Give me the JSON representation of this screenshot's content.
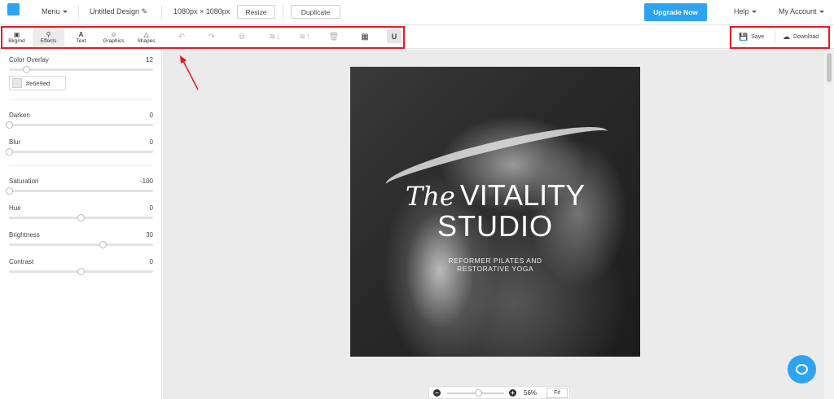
{
  "topbar": {
    "menu_label": "Menu",
    "design_name": "Untitled Design",
    "size_label": "1080px × 1080px",
    "resize_label": "Resize",
    "duplicate_label": "Duplicate",
    "upgrade_label": "Upgrade Now",
    "help_label": "Help",
    "account_label": "My Account",
    "accent_color": "#2ea3f2"
  },
  "toolbar": {
    "tools": [
      {
        "label": "Bkgrnd",
        "icon": "image-icon"
      },
      {
        "label": "Effects",
        "icon": "wand-icon"
      },
      {
        "label": "Text",
        "icon": "text-icon"
      },
      {
        "label": "Graphics",
        "icon": "smiley-icon"
      },
      {
        "label": "Shapes",
        "icon": "triangle-icon"
      }
    ],
    "actions": [
      "undo-icon",
      "redo-icon",
      "copy-icon",
      "layer-down-icon",
      "layer-up-icon",
      "trash-icon",
      "grid-icon",
      "magnet-icon"
    ],
    "save_label": "Save",
    "download_label": "Download"
  },
  "effects": {
    "color_overlay": {
      "label": "Color Overlay",
      "value": "12",
      "fraction": 0.12
    },
    "overlay_color": "#e6e9ed",
    "darken": {
      "label": "Darken",
      "value": "0",
      "fraction": 0.0
    },
    "blur": {
      "label": "Blur",
      "value": "0",
      "fraction": 0.0
    },
    "saturation": {
      "label": "Saturation",
      "value": "-100",
      "fraction": 0.0
    },
    "hue": {
      "label": "Hue",
      "value": "0",
      "fraction": 0.5
    },
    "brightness": {
      "label": "Brightness",
      "value": "30",
      "fraction": 0.65
    },
    "contrast": {
      "label": "Contrast",
      "value": "0",
      "fraction": 0.5
    }
  },
  "design": {
    "title_prefix": "The",
    "title_line1": "VITALITY",
    "title_line2": "STUDIO",
    "subtitle_line1": "REFORMER PILATES AND",
    "subtitle_line2": "RESTORATIVE YOGA"
  },
  "zoom": {
    "percent": "56%",
    "fit_label": "Fit",
    "level": 0.56
  }
}
